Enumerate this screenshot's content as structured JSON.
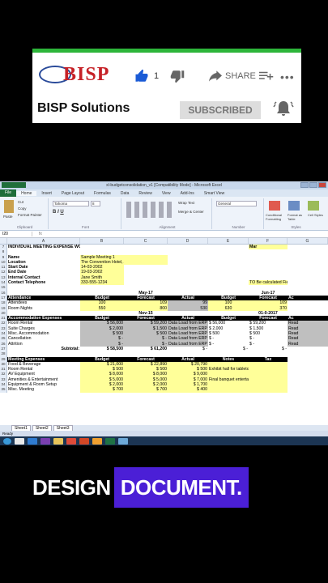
{
  "banner": {
    "logo_text": "BISP",
    "like_count": "1",
    "share_label": "SHARE",
    "more_label": "•••",
    "channel_name": "BISP Solutions",
    "subscribe_label": "SUBSCRIBED",
    "accent_color": "#2db53a"
  },
  "excel": {
    "window_title": "xl-budgetconsolidation_v1 [Compatibility Mode] - Microsoft Excel",
    "tabs": [
      "File",
      "Home",
      "Insert",
      "Page Layout",
      "Formulas",
      "Data",
      "Review",
      "View",
      "Add-Ins",
      "Smart View"
    ],
    "ribbon_groups": [
      "Clipboard",
      "Font",
      "Alignment",
      "Number",
      "Styles"
    ],
    "ribbon_items": {
      "cut": "Cut",
      "copy": "Copy",
      "format_painter": "Format Painter",
      "paste": "Paste",
      "font": "Tahoma",
      "font_size": "8",
      "wrap": "Wrap Text",
      "merge": "Merge & Center",
      "number_format": "General",
      "cond": "Conditional Formatting",
      "format_table": "Format as Table",
      "cell_styles": "Cell Styles"
    },
    "name_box": "I20",
    "fx": "fx",
    "columns": [
      "A",
      "B",
      "C",
      "D",
      "E",
      "F",
      "G"
    ],
    "rows": [
      {
        "n": "7",
        "cells": [
          "INDIVIDUAL MEETING EXPENSE WORKSHEET",
          "",
          "",
          "",
          "",
          "Mar",
          ""
        ]
      },
      {
        "n": "8",
        "cells": [
          "",
          "",
          "",
          "",
          "",
          "",
          ""
        ]
      },
      {
        "n": "9",
        "cells": [
          "Name",
          "Sample Meeting 1",
          "",
          "",
          "",
          "",
          ""
        ]
      },
      {
        "n": "10",
        "cells": [
          "Location",
          "The Convention Hotel, Anytown, USA",
          "",
          "",
          "",
          "",
          ""
        ]
      },
      {
        "n": "11",
        "cells": [
          "Start Date",
          "14-03-2002",
          "",
          "",
          "",
          "",
          ""
        ]
      },
      {
        "n": "12",
        "cells": [
          "End Date",
          "19-03-2002",
          "",
          "",
          "",
          "",
          ""
        ]
      },
      {
        "n": "13",
        "cells": [
          "Internal Contact",
          "Jane Smith",
          "",
          "",
          "",
          "",
          ""
        ]
      },
      {
        "n": "14",
        "cells": [
          "Contact Telephone",
          "333-555-1234",
          "",
          "",
          "",
          "TO Be calculated Field",
          ""
        ]
      },
      {
        "n": "15",
        "cells": [
          "",
          "",
          "",
          "",
          "",
          "",
          ""
        ]
      },
      {
        "n": "16",
        "cells": [
          "",
          "",
          "May-17",
          "",
          "",
          "Jun-17",
          ""
        ]
      },
      {
        "n": "17",
        "cells": [
          "Attendance",
          "Budget",
          "Forecast",
          "Actual",
          "Budget",
          "Forecast",
          "Ac"
        ]
      },
      {
        "n": "18",
        "cells": [
          "Attendees",
          "100",
          "109",
          "99",
          "100",
          "109",
          ""
        ]
      },
      {
        "n": "19",
        "cells": [
          "Room Nights",
          "550",
          "800",
          "530",
          "630",
          "370",
          ""
        ]
      },
      {
        "n": "20",
        "cells": [
          "",
          "",
          "Nov-15",
          "",
          "",
          "01-0-2017",
          ""
        ]
      },
      {
        "n": "21",
        "cells": [
          "Accommodation Expenses",
          "Budget",
          "Forecast",
          "Actual",
          "Budget",
          "Forecast",
          "Ac"
        ]
      },
      {
        "n": "22",
        "cells": [
          "Room Rental",
          "$ 56,000",
          "$ 59,200",
          "Data Load from ERP",
          "$ 56,000",
          "$ 59,200",
          "Read"
        ]
      },
      {
        "n": "23",
        "cells": [
          "Suite Charges",
          "$ 2,000",
          "$ 1,500",
          "Data Load from ERP",
          "$ 2,000",
          "$ 1,500",
          "Read"
        ]
      },
      {
        "n": "24",
        "cells": [
          "Misc. Accommodation",
          "$ 500",
          "$ 500",
          "Data Load from ERP",
          "$ 500",
          "$ 500",
          "Read"
        ]
      },
      {
        "n": "25",
        "cells": [
          "Cancellation",
          "$ -",
          "$ -",
          "Data Load from ERP",
          "$ -",
          "$ -",
          "Read"
        ]
      },
      {
        "n": "26",
        "cells": [
          "Attrition",
          "$ -",
          "$ -",
          "Data Load from ERP",
          "$ -",
          "$ -",
          "Read"
        ]
      },
      {
        "n": "27",
        "cells": [
          "Subtotal:",
          "$ 58,500",
          "$ 61,200",
          "$ -",
          "$ -",
          "$ -",
          ""
        ]
      },
      {
        "n": "28",
        "cells": [
          "",
          "",
          "",
          "",
          "",
          "",
          ""
        ]
      },
      {
        "n": "29",
        "cells": [
          "Meeting Expenses",
          "Budget",
          "Forecast",
          "Actual",
          "Notes",
          "Tax",
          ""
        ]
      },
      {
        "n": "30",
        "cells": [
          "Food & Beverage",
          "$ 21,000",
          "$ 22,890",
          "$ 20,790",
          "",
          "",
          ""
        ]
      },
      {
        "n": "31",
        "cells": [
          "Room Rental",
          "$ 500",
          "$ 500",
          "$ 500",
          "Exhibit hall for tabletop display.",
          "",
          ""
        ]
      },
      {
        "n": "32",
        "cells": [
          "AV Equipment",
          "$ 8,000",
          "$ 8,000",
          "$ 9,000",
          "",
          "",
          ""
        ]
      },
      {
        "n": "33",
        "cells": [
          "Amenities & Entertainment",
          "$ 5,000",
          "$ 5,000",
          "$ 7,000",
          "Final banquet entertainment.",
          "",
          ""
        ]
      },
      {
        "n": "34",
        "cells": [
          "Equipment & Room Setup",
          "$ 2,000",
          "$ 2,000",
          "$ 1,700",
          "",
          "",
          ""
        ]
      },
      {
        "n": "35",
        "cells": [
          "Misc. Meeting",
          "$ 700",
          "$ 700",
          "$ 400",
          "",
          "",
          ""
        ]
      }
    ],
    "sheet_tabs": [
      "Sheet1",
      "Sheet2",
      "Sheet3"
    ],
    "status": "Ready"
  },
  "caption": {
    "left": "DESIGN",
    "right": "DOCUMENT."
  }
}
